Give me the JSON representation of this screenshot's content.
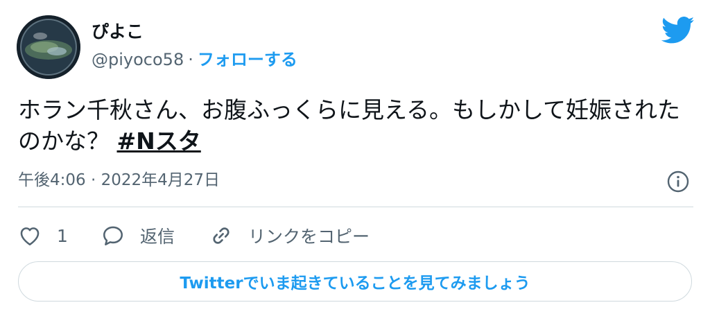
{
  "author": {
    "display_name": "ぴよこ",
    "handle": "@piyoco58",
    "separator": "·",
    "follow_label": "フォローする",
    "avatar_icon": "profile-avatar"
  },
  "brand": {
    "icon": "twitter-bird-icon",
    "color": "#1d9bf0"
  },
  "tweet": {
    "text": "ホラン千秋さん、お腹ふっくらに見える。もしかして妊娠されたのかな？ ",
    "hashtag": "#Nスタ",
    "timestamp": "午後4:06 · 2022年4月27日"
  },
  "actions": {
    "like_count": "1",
    "reply_label": "返信",
    "copy_link_label": "リンクをコピー"
  },
  "cta_label": "Twitterでいま起きていることを見てみましょう",
  "colors": {
    "accent": "#1d9bf0",
    "text": "#0f1419",
    "secondary": "#536471",
    "border": "#cfd9de"
  }
}
